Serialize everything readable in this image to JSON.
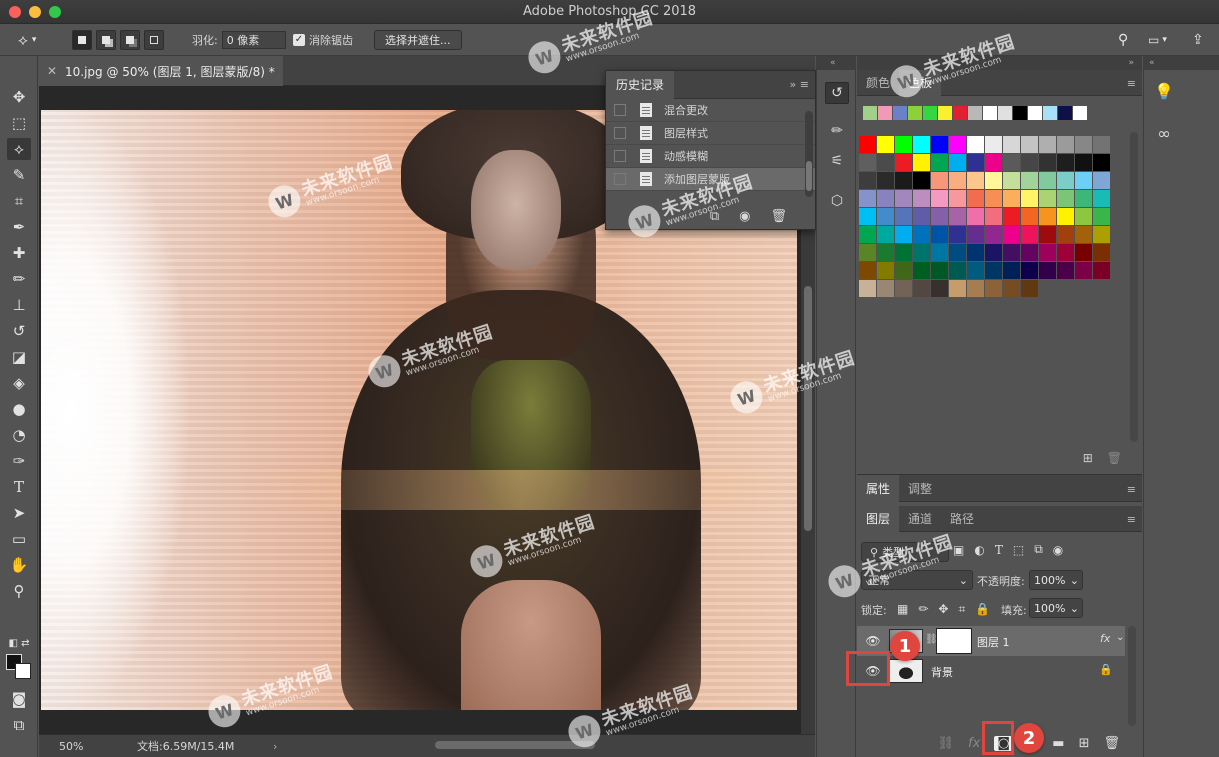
{
  "window": {
    "title": "Adobe Photoshop CC 2018"
  },
  "options_bar": {
    "feather_label": "羽化:",
    "feather_value": "0 像素",
    "antialias_label": "消除锯齿",
    "antialias_checked": true,
    "select_mask_button": "选择并遮住..."
  },
  "document": {
    "tab_title": "10.jpg @ 50% (图层 1, 图层蒙版/8) *",
    "zoom": "50%",
    "doc_size": "文档:6.59M/15.4M"
  },
  "history_panel": {
    "tab": "历史记录",
    "items": [
      "混合更改",
      "图层样式",
      "动感模糊",
      "添加图层蒙版"
    ],
    "selected_index": 3
  },
  "swatches_panel": {
    "tabs": [
      "颜色",
      "色板"
    ],
    "active_tab": "色板",
    "recent": [
      "#a0d08a",
      "#f09ab8",
      "#6a80c8",
      "#8cd03a",
      "#33d840",
      "#f8f030",
      "#e02030",
      "#b8b8b8",
      "#ffffff",
      "#e0e0e0",
      "#000000",
      "#ffffff",
      "#a8e0f8",
      "#101048",
      "#ffffff"
    ],
    "grid": [
      "#ff0000",
      "#ffff00",
      "#00ff00",
      "#00ffff",
      "#0000ff",
      "#ff00ff",
      "#ffffff",
      "#ebebeb",
      "#d7d7d7",
      "#c3c3c3",
      "#afafaf",
      "#9b9b9b",
      "#878787",
      "#737373",
      "#5f5f5f",
      "#4b4b4b",
      "#ed1c24",
      "#fff200",
      "#00a651",
      "#00aeef",
      "#2e3192",
      "#ec008c",
      "#5a5a5a",
      "#464646",
      "#323232",
      "#1e1e1e",
      "#111111",
      "#000000",
      "#3d3d3d",
      "#2b2b2b",
      "#1b1b1b",
      "#000000",
      "#f7977a",
      "#f9ad81",
      "#fdc68a",
      "#fff79a",
      "#c4df9b",
      "#a3d39c",
      "#82ca9d",
      "#7bcdc8",
      "#6ecff6",
      "#7ea7d8",
      "#8493ca",
      "#8882be",
      "#a187be",
      "#bc8dbf",
      "#f49ac2",
      "#f6989d",
      "#f26c4f",
      "#f68e55",
      "#fbaf5c",
      "#fff467",
      "#acd372",
      "#7cc576",
      "#3bb878",
      "#1abbb4",
      "#00bff3",
      "#438ccb",
      "#5574b9",
      "#605ca8",
      "#855fa8",
      "#a763a8",
      "#f06ea9",
      "#f26d7d",
      "#ed1c24",
      "#f26522",
      "#f7941d",
      "#fff200",
      "#8dc73f",
      "#39b54a",
      "#00a651",
      "#00a99d",
      "#00aeef",
      "#0072bc",
      "#0054a6",
      "#2e3192",
      "#662d91",
      "#92278f",
      "#ec008c",
      "#ed145b",
      "#9e0b0f",
      "#a0410d",
      "#a3620a",
      "#aba000",
      "#598527",
      "#1a7b30",
      "#007236",
      "#00746b",
      "#0076a3",
      "#004b80",
      "#003471",
      "#1b1464",
      "#440e62",
      "#630460",
      "#9e005d",
      "#9e0039",
      "#790000",
      "#7b2e00",
      "#7d4900",
      "#827b00",
      "#406618",
      "#005e20",
      "#005826",
      "#005952",
      "#005b7f",
      "#003663",
      "#002157",
      "#0d004c",
      "#32004b",
      "#4b0049",
      "#7b0046",
      "#7a0026",
      "#c7b299",
      "#998675",
      "#736357",
      "#534741",
      "#37302d",
      "#c69c6d",
      "#a67c52",
      "#8c6239",
      "#754c24",
      "#603913"
    ]
  },
  "properties_tabs": {
    "tabs": [
      "属性",
      "调整"
    ],
    "active_tab": "属性"
  },
  "layers_panel": {
    "tabs": [
      "图层",
      "通道",
      "路径"
    ],
    "active_tab": "图层",
    "kind_filter": "类型",
    "blend_mode": "正常",
    "opacity_label": "不透明度:",
    "opacity_value": "100%",
    "lock_label": "锁定:",
    "fill_label": "填充:",
    "fill_value": "100%",
    "layers": [
      {
        "name": "图层 1",
        "selected": true,
        "has_mask": true,
        "fx": "fx"
      },
      {
        "name": "背景",
        "selected": false,
        "locked": true
      }
    ]
  },
  "callouts": [
    {
      "number": "1"
    },
    {
      "number": "2"
    }
  ],
  "watermark": {
    "brand": "未来软件园",
    "url": "www.orsoon.com"
  }
}
